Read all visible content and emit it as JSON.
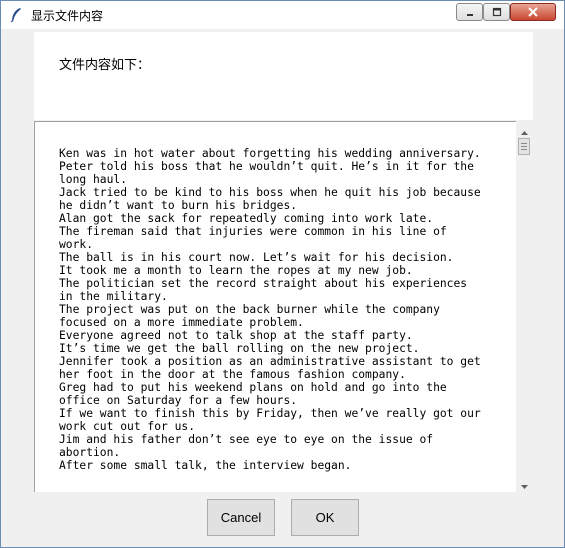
{
  "window": {
    "title": "显示文件内容",
    "title_icon": "feather-icon",
    "controls": [
      "minimize-icon",
      "maximize-icon",
      "close-icon"
    ],
    "close_color": "#c9462f"
  },
  "header": {
    "label": "文件内容如下："
  },
  "content": {
    "lines": [
      "Ken was in hot water about forgetting his wedding anniversary.",
      "Peter told his boss that he wouldn’t quit. He’s in it for the",
      "long haul.",
      "Jack tried to be kind to his boss when he quit his job because",
      "he didn’t want to burn his bridges.",
      "Alan got the sack for repeatedly coming into work late.",
      "The fireman said that injuries were common in his line of",
      "work.",
      "The ball is in his court now. Let’s wait for his decision.",
      "It took me a month to learn the ropes at my new job.",
      "The politician set the record straight about his experiences",
      "in the military.",
      "The project was put on the back burner while the company",
      "focused on a more immediate problem.",
      "Everyone agreed not to talk shop at the staff party.",
      "It’s time we get the ball rolling on the new project.",
      "Jennifer took a position as an administrative assistant to get",
      "her foot in the door at the famous fashion company.",
      "Greg had to put his weekend plans on hold and go into the",
      "office on Saturday for a few hours.",
      "If we want to finish this by Friday, then we’ve really got our",
      "work cut out for us.",
      "Jim and his father don’t see eye to eye on the issue of",
      "abortion.",
      "After some small talk, the interview began."
    ]
  },
  "buttons": {
    "cancel": "Cancel",
    "ok": "OK"
  }
}
